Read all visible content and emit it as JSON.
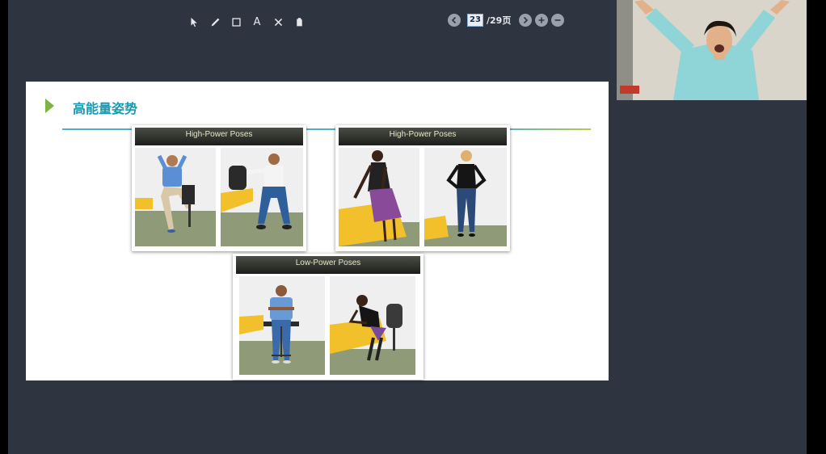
{
  "toolbar": {
    "tools": [
      {
        "name": "pointer-tool-icon"
      },
      {
        "name": "pen-tool-icon"
      },
      {
        "name": "rectangle-tool-icon"
      },
      {
        "name": "text-tool",
        "glyph": "A"
      },
      {
        "name": "clear-tool-icon"
      },
      {
        "name": "eraser-tool-icon"
      }
    ]
  },
  "pager": {
    "current_page": "23",
    "total_label": "/29页"
  },
  "slide": {
    "title": "高能量姿势",
    "cards": [
      {
        "header": "High-Power Poses"
      },
      {
        "header": "High-Power Poses"
      },
      {
        "header": "Low-Power Poses"
      }
    ]
  },
  "colors": {
    "background": "#2f3540",
    "accent_teal": "#1a9ab0",
    "accent_green": "#7cb342",
    "table_yellow": "#f2c02a"
  }
}
